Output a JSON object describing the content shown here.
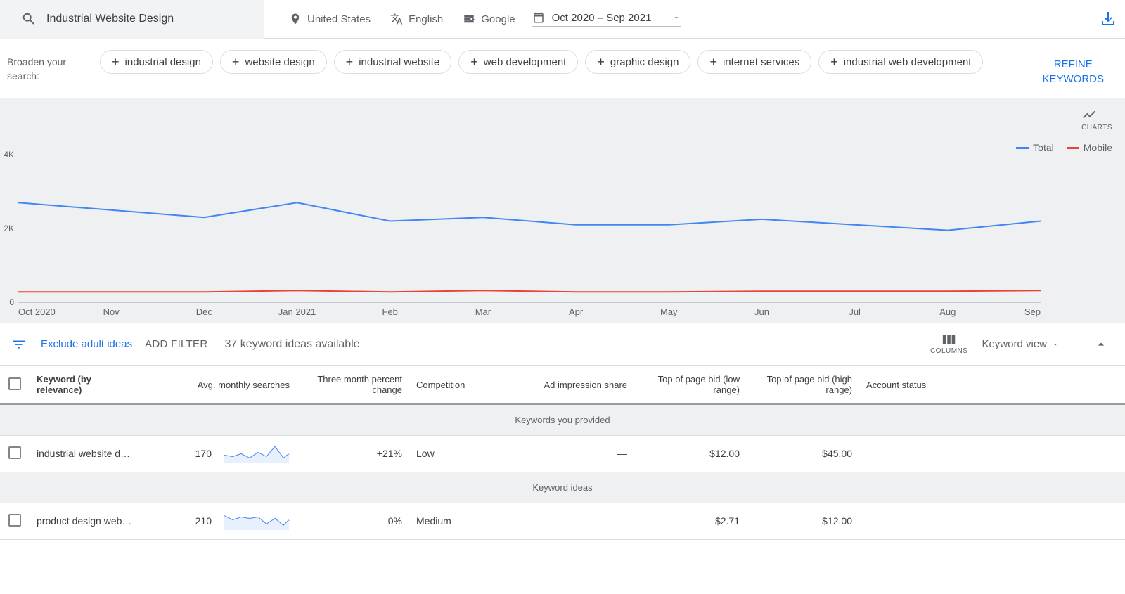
{
  "top": {
    "search_value": "Industrial Website Design",
    "location": "United States",
    "language": "English",
    "network": "Google",
    "date_range": "Oct 2020 – Sep 2021"
  },
  "broaden": {
    "label": "Broaden your search:",
    "chips": [
      "industrial design",
      "website design",
      "industrial website",
      "web development",
      "graphic design",
      "internet services",
      "industrial web development"
    ],
    "refine": "REFINE KEYWORDS"
  },
  "chart_data": {
    "type": "line",
    "title": "",
    "xlabel": "",
    "ylabel": "",
    "ylim": [
      0,
      4000
    ],
    "yticks": [
      "0",
      "2K",
      "4K"
    ],
    "categories": [
      "Oct 2020",
      "Nov",
      "Dec",
      "Jan 2021",
      "Feb",
      "Mar",
      "Apr",
      "May",
      "Jun",
      "Jul",
      "Aug",
      "Sep"
    ],
    "series": [
      {
        "name": "Total",
        "color": "#4285f4",
        "values": [
          2700,
          2500,
          2300,
          2700,
          2200,
          2300,
          2100,
          2100,
          2250,
          2100,
          1950,
          2200
        ]
      },
      {
        "name": "Mobile",
        "color": "#ea4335",
        "values": [
          280,
          280,
          280,
          320,
          280,
          320,
          280,
          280,
          300,
          300,
          300,
          320
        ]
      }
    ],
    "legend": {
      "total": "Total",
      "mobile": "Mobile"
    },
    "charts_label": "CHARTS"
  },
  "filterbar": {
    "exclude": "Exclude adult ideas",
    "add_filter": "ADD FILTER",
    "available": "37 keyword ideas available",
    "columns": "COLUMNS",
    "view": "Keyword view"
  },
  "table": {
    "headers": {
      "keyword": "Keyword (by relevance)",
      "avg": "Avg. monthly searches",
      "change": "Three month percent change",
      "competition": "Competition",
      "impression": "Ad impression share",
      "low_bid": "Top of page bid (low range)",
      "high_bid": "Top of page bid (high range)",
      "account": "Account status"
    },
    "sections": {
      "provided": "Keywords you provided",
      "ideas": "Keyword ideas"
    },
    "rows": [
      {
        "keyword": "industrial website d…",
        "avg": "170",
        "change": "+21%",
        "competition": "Low",
        "impression": "—",
        "low": "$12.00",
        "high": "$45.00",
        "account": ""
      },
      {
        "keyword": "product design web…",
        "avg": "210",
        "change": "0%",
        "competition": "Medium",
        "impression": "—",
        "low": "$2.71",
        "high": "$12.00",
        "account": ""
      }
    ]
  }
}
